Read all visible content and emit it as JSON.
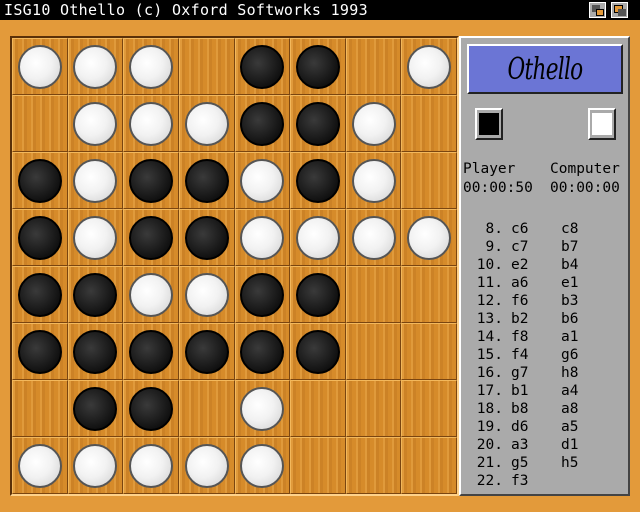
{
  "window": {
    "title": "ISG10 Othello (c) Oxford Softworks 1993"
  },
  "board": [
    [
      "w",
      "w",
      "w",
      "",
      "b",
      "b",
      "",
      "w"
    ],
    [
      "",
      "w",
      "w",
      "w",
      "b",
      "b",
      "w",
      ""
    ],
    [
      "b",
      "w",
      "b",
      "b",
      "w",
      "b",
      "w",
      ""
    ],
    [
      "b",
      "w",
      "b",
      "b",
      "w",
      "w",
      "w",
      "w"
    ],
    [
      "b",
      "b",
      "w",
      "w",
      "b",
      "b",
      "",
      ""
    ],
    [
      "b",
      "b",
      "b",
      "b",
      "b",
      "b",
      "",
      ""
    ],
    [
      "",
      "b",
      "b",
      "",
      "w",
      "",
      "",
      ""
    ],
    [
      "w",
      "w",
      "w",
      "w",
      "w",
      "",
      "",
      ""
    ]
  ],
  "panel": {
    "logo": "Othello",
    "player_label": "Player",
    "computer_label": "Computer",
    "player_time": "00:00:50",
    "computer_time": "00:00:00",
    "player_color": "#000000",
    "computer_color": "#ffffff"
  },
  "moves": [
    {
      "n": "8.",
      "p": "c6",
      "c": "c8"
    },
    {
      "n": "9.",
      "p": "c7",
      "c": "b7"
    },
    {
      "n": "10.",
      "p": "e2",
      "c": "b4"
    },
    {
      "n": "11.",
      "p": "a6",
      "c": "e1"
    },
    {
      "n": "12.",
      "p": "f6",
      "c": "b3"
    },
    {
      "n": "13.",
      "p": "b2",
      "c": "b6"
    },
    {
      "n": "14.",
      "p": "f8",
      "c": "a1"
    },
    {
      "n": "15.",
      "p": "f4",
      "c": "g6"
    },
    {
      "n": "16.",
      "p": "g7",
      "c": "h8"
    },
    {
      "n": "17.",
      "p": "b1",
      "c": "a4"
    },
    {
      "n": "18.",
      "p": "b8",
      "c": "a8"
    },
    {
      "n": "19.",
      "p": "d6",
      "c": "a5"
    },
    {
      "n": "20.",
      "p": "a3",
      "c": "d1"
    },
    {
      "n": "21.",
      "p": "g5",
      "c": "h5"
    },
    {
      "n": "22.",
      "p": "f3",
      "c": ""
    }
  ]
}
